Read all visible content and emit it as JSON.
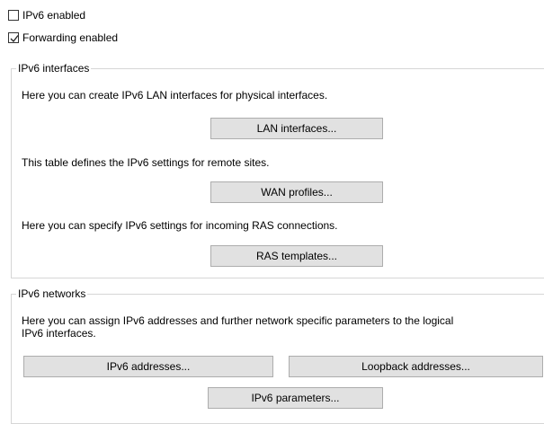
{
  "checkboxes": {
    "ipv6_enabled": {
      "label": "IPv6 enabled",
      "checked": false
    },
    "forwarding_enabled": {
      "label": "Forwarding enabled",
      "checked": true
    }
  },
  "ipv6_interfaces": {
    "title": "IPv6 interfaces",
    "lan_text": "Here you can create IPv6 LAN interfaces for physical interfaces.",
    "lan_button": "LAN interfaces...",
    "wan_text": "This table defines the IPv6 settings for remote sites.",
    "wan_button": "WAN profiles...",
    "ras_text": "Here you can specify IPv6 settings for incoming RAS connections.",
    "ras_button": "RAS templates..."
  },
  "ipv6_networks": {
    "title": "IPv6 networks",
    "text_line1": "Here you can assign IPv6 addresses and further network specific parameters to the logical",
    "text_line2": "IPv6 interfaces.",
    "addresses_button": "IPv6 addresses...",
    "loopback_button": "Loopback addresses...",
    "parameters_button": "IPv6 parameters..."
  }
}
